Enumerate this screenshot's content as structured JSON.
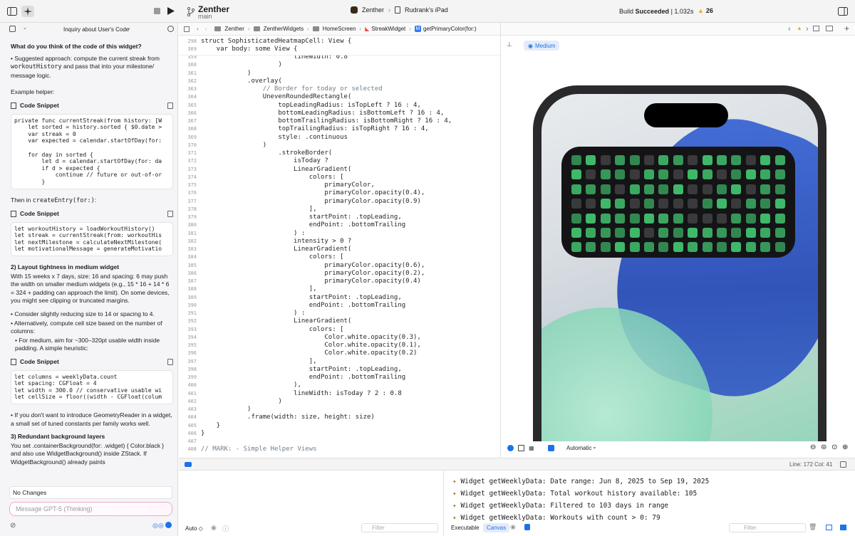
{
  "toolbar": {
    "project": "Zenther",
    "branch": "main",
    "scheme": "Zenther",
    "scheme_sep": "›",
    "destination": "Rudrank's iPad",
    "build_prefix": "Build",
    "build_status": "Succeeded",
    "build_time": "| 1.032s",
    "warnings": "26"
  },
  "jumpbar": {
    "items": [
      "Zenther",
      "ZentherWidgets",
      "HomeScreen",
      "StreakWidget",
      "getPrimaryColor(for:)"
    ]
  },
  "chat": {
    "title": "Inquiry about User's Code",
    "question": "What do you think of the code of this widget?",
    "p1_pre": "• Suggested approach: compute the current streak from ",
    "p1_code": "workoutHistory",
    "p1_post": " and pass that into your milestone/ message logic.",
    "p2": "Example helper:",
    "snippet_label": "Code Snippet",
    "snippet1": [
      "private func currentStreak(from history: [W",
      "    let sorted = history.sorted { $0.date >",
      "    var streak = 0",
      "    var expected = calendar.startOfDay(for:",
      "",
      "    for day in sorted {",
      "        let d = calendar.startOfDay(for: da",
      "        if d > expected {",
      "            continue // future or out-of-or",
      "        }"
    ],
    "p3_pre": "Then in ",
    "p3_code": "createEntry(for:)",
    "p3_post": ":",
    "snippet2": [
      "let workoutHistory = loadWorkoutHistory()",
      "let streak = currentStreak(from: workoutHis",
      "let nextMilestone = calculateNextMilestone(",
      "let motivationalMessage = generateMotivatio"
    ],
    "h2": "2) Layout tightness in medium widget",
    "p4": "With 15 weeks x 7 days, size: 16 and spacing: 6 may push the width on smaller medium widgets (e.g., 15 * 16 + 14 * 6 = 324 + padding can approach the limit). On some devices, you might see clipping or truncated margins.",
    "p5": "• Consider slightly reducing size to 14 or spacing to 4.",
    "p6": "• Alternatively, compute cell size based on the number of columns:",
    "p7": "• For medium, aim for ~300–320pt usable width inside padding. A simple heuristic:",
    "snippet3": [
      "let columns = weeklyData.count",
      "let spacing: CGFloat = 4",
      "let width = 300.0 // conservative usable wi",
      "let cellSize = floor((width - CGFloat(colum"
    ],
    "p8": "• If you don't want to introduce GeometryReader in a widget, a small set of tuned constants per family works well.",
    "h3": "3) Redundant background layers",
    "p9": "You set .containerBackground(for: .widget) { Color.black } and also use WidgetBackground() inside ZStack. If WidgetBackground() already paints",
    "no_changes": "No Changes",
    "message_placeholder": "Message GPT-5 (Thinking)"
  },
  "editor": {
    "sticky": [
      {
        "n": "298",
        "t": "struct SophisticatedHeatmapCell: View {"
      },
      {
        "n": "309",
        "t": "    var body: some View {"
      }
    ],
    "lines": [
      {
        "n": "359",
        "t": "                        lineWidth: 0.8"
      },
      {
        "n": "360",
        "t": "                    )"
      },
      {
        "n": "361",
        "t": "            )"
      },
      {
        "n": "362",
        "t": "            .overlay("
      },
      {
        "n": "363",
        "t": "                // Border for today or selected"
      },
      {
        "n": "364",
        "t": "                UnevenRoundedRectangle("
      },
      {
        "n": "365",
        "t": "                    topLeadingRadius: isTopLeft ? 16 : 4,"
      },
      {
        "n": "366",
        "t": "                    bottomLeadingRadius: isBottomLeft ? 16 : 4,"
      },
      {
        "n": "367",
        "t": "                    bottomTrailingRadius: isBottomRight ? 16 : 4,"
      },
      {
        "n": "368",
        "t": "                    topTrailingRadius: isTopRight ? 16 : 4,"
      },
      {
        "n": "369",
        "t": "                    style: .continuous"
      },
      {
        "n": "370",
        "t": "                )"
      },
      {
        "n": "371",
        "t": "                    .strokeBorder("
      },
      {
        "n": "372",
        "t": "                        isToday ?"
      },
      {
        "n": "373",
        "t": "                        LinearGradient("
      },
      {
        "n": "374",
        "t": "                            colors: ["
      },
      {
        "n": "375",
        "t": "                                primaryColor,"
      },
      {
        "n": "376",
        "t": "                                primaryColor.opacity(0.4),"
      },
      {
        "n": "377",
        "t": "                                primaryColor.opacity(0.9)"
      },
      {
        "n": "378",
        "t": "                            ],"
      },
      {
        "n": "379",
        "t": "                            startPoint: .topLeading,"
      },
      {
        "n": "380",
        "t": "                            endPoint: .bottomTrailing"
      },
      {
        "n": "381",
        "t": "                        ) :"
      },
      {
        "n": "382",
        "t": "                        intensity > 0 ?"
      },
      {
        "n": "383",
        "t": "                        LinearGradient("
      },
      {
        "n": "384",
        "t": "                            colors: ["
      },
      {
        "n": "385",
        "t": "                                primaryColor.opacity(0.6),"
      },
      {
        "n": "386",
        "t": "                                primaryColor.opacity(0.2),"
      },
      {
        "n": "387",
        "t": "                                primaryColor.opacity(0.4)"
      },
      {
        "n": "388",
        "t": "                            ],"
      },
      {
        "n": "389",
        "t": "                            startPoint: .topLeading,"
      },
      {
        "n": "390",
        "t": "                            endPoint: .bottomTrailing"
      },
      {
        "n": "391",
        "t": "                        ) :"
      },
      {
        "n": "392",
        "t": "                        LinearGradient("
      },
      {
        "n": "393",
        "t": "                            colors: ["
      },
      {
        "n": "394",
        "t": "                                Color.white.opacity(0.3),"
      },
      {
        "n": "395",
        "t": "                                Color.white.opacity(0.1),"
      },
      {
        "n": "396",
        "t": "                                Color.white.opacity(0.2)"
      },
      {
        "n": "397",
        "t": "                            ],"
      },
      {
        "n": "398",
        "t": "                            startPoint: .topLeading,"
      },
      {
        "n": "399",
        "t": "                            endPoint: .bottomTrailing"
      },
      {
        "n": "400",
        "t": "                        ),"
      },
      {
        "n": "401",
        "t": "                        lineWidth: isToday ? 2 : 0.8"
      },
      {
        "n": "402",
        "t": "                    )"
      },
      {
        "n": "403",
        "t": "            )"
      },
      {
        "n": "404",
        "t": "            .frame(width: size, height: size)"
      },
      {
        "n": "405",
        "t": "    }"
      },
      {
        "n": "406",
        "t": "}"
      },
      {
        "n": "407",
        "t": ""
      },
      {
        "n": "408",
        "t": "// MARK: - Simple Helper Views"
      }
    ]
  },
  "canvas": {
    "badge": "Medium",
    "mode": "Automatic"
  },
  "statusbar": {
    "line": "Line: 172",
    "col": "Col: 41"
  },
  "console": {
    "lines": [
      "Widget getWeeklyData: Date range: Jun 8, 2025 to Sep 19, 2025",
      "Widget getWeeklyData: Total workout history available: 105",
      "Widget getWeeklyData: Filtered to 103 days in range",
      "Widget getWeeklyData: Workouts with count > 0: 79"
    ],
    "executable": "Executable",
    "canvas_tab": "Canvas",
    "filter": "Filter"
  },
  "debug": {
    "auto": "Auto ◇",
    "filter": "Filter"
  },
  "colors": {
    "accent": "#1a73e8",
    "green": "#34c759",
    "widget_bg": "#141416"
  },
  "widget_grid": {
    "columns": 15,
    "rows": 7,
    "levels": [
      [
        1,
        1,
        0,
        1,
        1,
        0,
        1,
        1,
        0,
        1,
        1,
        1,
        0,
        1,
        1
      ],
      [
        1,
        0,
        1,
        1,
        0,
        1,
        1,
        0,
        1,
        1,
        0,
        1,
        1,
        1,
        1
      ],
      [
        1,
        1,
        1,
        0,
        1,
        1,
        1,
        1,
        0,
        0,
        1,
        1,
        0,
        1,
        1
      ],
      [
        0,
        0,
        1,
        1,
        0,
        1,
        0,
        0,
        0,
        1,
        1,
        0,
        1,
        1,
        1
      ],
      [
        1,
        1,
        1,
        1,
        1,
        1,
        1,
        1,
        0,
        0,
        0,
        1,
        1,
        1,
        1
      ],
      [
        1,
        1,
        1,
        1,
        1,
        0,
        1,
        1,
        1,
        1,
        1,
        1,
        1,
        1,
        1
      ],
      [
        1,
        1,
        1,
        1,
        1,
        1,
        1,
        1,
        1,
        1,
        1,
        1,
        1,
        1,
        1
      ]
    ]
  }
}
